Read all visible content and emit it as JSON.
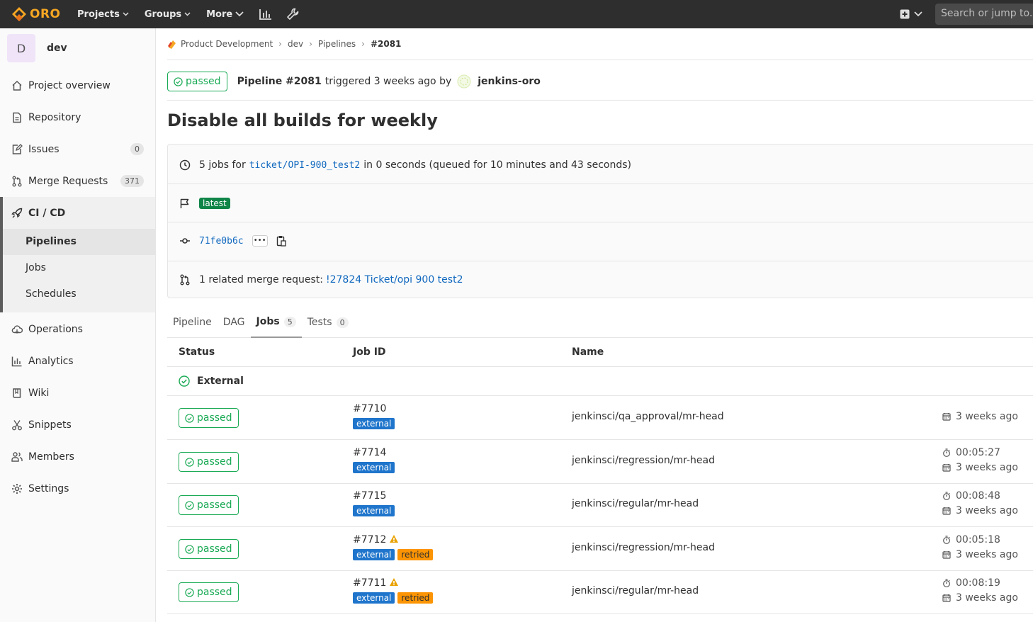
{
  "navbar": {
    "brand": "ORO",
    "projects": "Projects",
    "groups": "Groups",
    "more": "More",
    "search_placeholder": "Search or jump to..."
  },
  "sidebar": {
    "avatar_letter": "D",
    "project_name": "dev",
    "items": [
      {
        "label": "Project overview",
        "icon": "home-icon"
      },
      {
        "label": "Repository",
        "icon": "doc-icon"
      },
      {
        "label": "Issues",
        "icon": "issues-icon",
        "count": "0"
      },
      {
        "label": "Merge Requests",
        "icon": "merge-request-icon",
        "count": "371"
      },
      {
        "label": "CI / CD",
        "icon": "rocket-icon"
      },
      {
        "label": "Operations",
        "icon": "cloud-icon"
      },
      {
        "label": "Analytics",
        "icon": "chart-icon"
      },
      {
        "label": "Wiki",
        "icon": "book-icon"
      },
      {
        "label": "Snippets",
        "icon": "scissors-icon"
      },
      {
        "label": "Members",
        "icon": "users-icon"
      },
      {
        "label": "Settings",
        "icon": "gear-icon"
      }
    ],
    "cicd_sub": [
      "Pipelines",
      "Jobs",
      "Schedules"
    ]
  },
  "breadcrumb": [
    "Product Development",
    "dev",
    "Pipelines",
    "#2081"
  ],
  "header": {
    "status": "passed",
    "pipeline": "Pipeline #2081",
    "triggered": "triggered 3 weeks ago by",
    "user": "jenkins-oro"
  },
  "title": "Disable all builds for weekly",
  "info": {
    "jobs_prefix": "5 jobs for",
    "branch": "ticket/OPI-900_test2",
    "jobs_suffix": "in 0 seconds (queued for 10 minutes and 43 seconds)",
    "latest": "latest",
    "commit": "71fe0b6c",
    "mr_prefix": "1 related merge request:",
    "mr_link": "!27824 Ticket/opi 900 test2"
  },
  "tabs": [
    {
      "label": "Pipeline"
    },
    {
      "label": "DAG"
    },
    {
      "label": "Jobs",
      "count": "5"
    },
    {
      "label": "Tests",
      "count": "0"
    }
  ],
  "table": {
    "headers": [
      "Status",
      "Job ID",
      "Name"
    ],
    "stage": "External",
    "rows": [
      {
        "status": "passed",
        "id": "#7710",
        "badges": [
          "external"
        ],
        "warning": false,
        "name": "jenkinsci/qa_approval/mr-head",
        "duration": "",
        "finished": "3 weeks ago"
      },
      {
        "status": "passed",
        "id": "#7714",
        "badges": [
          "external"
        ],
        "warning": false,
        "name": "jenkinsci/regression/mr-head",
        "duration": "00:05:27",
        "finished": "3 weeks ago"
      },
      {
        "status": "passed",
        "id": "#7715",
        "badges": [
          "external"
        ],
        "warning": false,
        "name": "jenkinsci/regular/mr-head",
        "duration": "00:08:48",
        "finished": "3 weeks ago"
      },
      {
        "status": "passed",
        "id": "#7712",
        "badges": [
          "external",
          "retried"
        ],
        "warning": true,
        "name": "jenkinsci/regression/mr-head",
        "duration": "00:05:18",
        "finished": "3 weeks ago"
      },
      {
        "status": "passed",
        "id": "#7711",
        "badges": [
          "external",
          "retried"
        ],
        "warning": true,
        "name": "jenkinsci/regular/mr-head",
        "duration": "00:08:19",
        "finished": "3 weeks ago"
      }
    ]
  },
  "colors": {
    "success": "#1aaa55",
    "link": "#1068bf",
    "external_badge": "#1f75cb",
    "retried_badge": "#fc9403",
    "latest_badge": "#108548",
    "navbar": "#2e2e2e"
  }
}
